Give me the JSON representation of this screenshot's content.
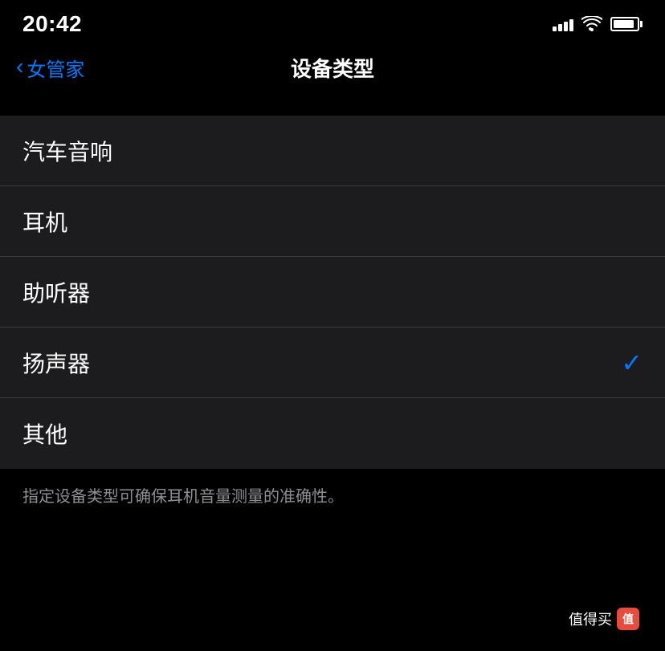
{
  "statusBar": {
    "time": "20:42",
    "locationIcon": "◂",
    "signalBars": [
      6,
      9,
      12,
      15,
      18
    ],
    "wifiLabel": "wifi-icon",
    "batteryLabel": "battery-icon"
  },
  "navBar": {
    "backLabel": "女管家",
    "title": "设备类型"
  },
  "listItems": [
    {
      "id": "car-audio",
      "label": "汽车音响",
      "selected": false
    },
    {
      "id": "headphones",
      "label": "耳机",
      "selected": false
    },
    {
      "id": "hearing-aid",
      "label": "助听器",
      "selected": false
    },
    {
      "id": "speaker",
      "label": "扬声器",
      "selected": true
    },
    {
      "id": "other",
      "label": "其他",
      "selected": false
    }
  ],
  "footer": {
    "description": "指定设备类型可确保耳机音量测量的准确性。"
  },
  "watermark": {
    "text": "值得买",
    "logo": "值"
  },
  "colors": {
    "accent": "#007AFF",
    "background": "#000000",
    "listBackground": "#1c1c1e",
    "separator": "#3a3a3c",
    "footerText": "#8e8e93"
  }
}
